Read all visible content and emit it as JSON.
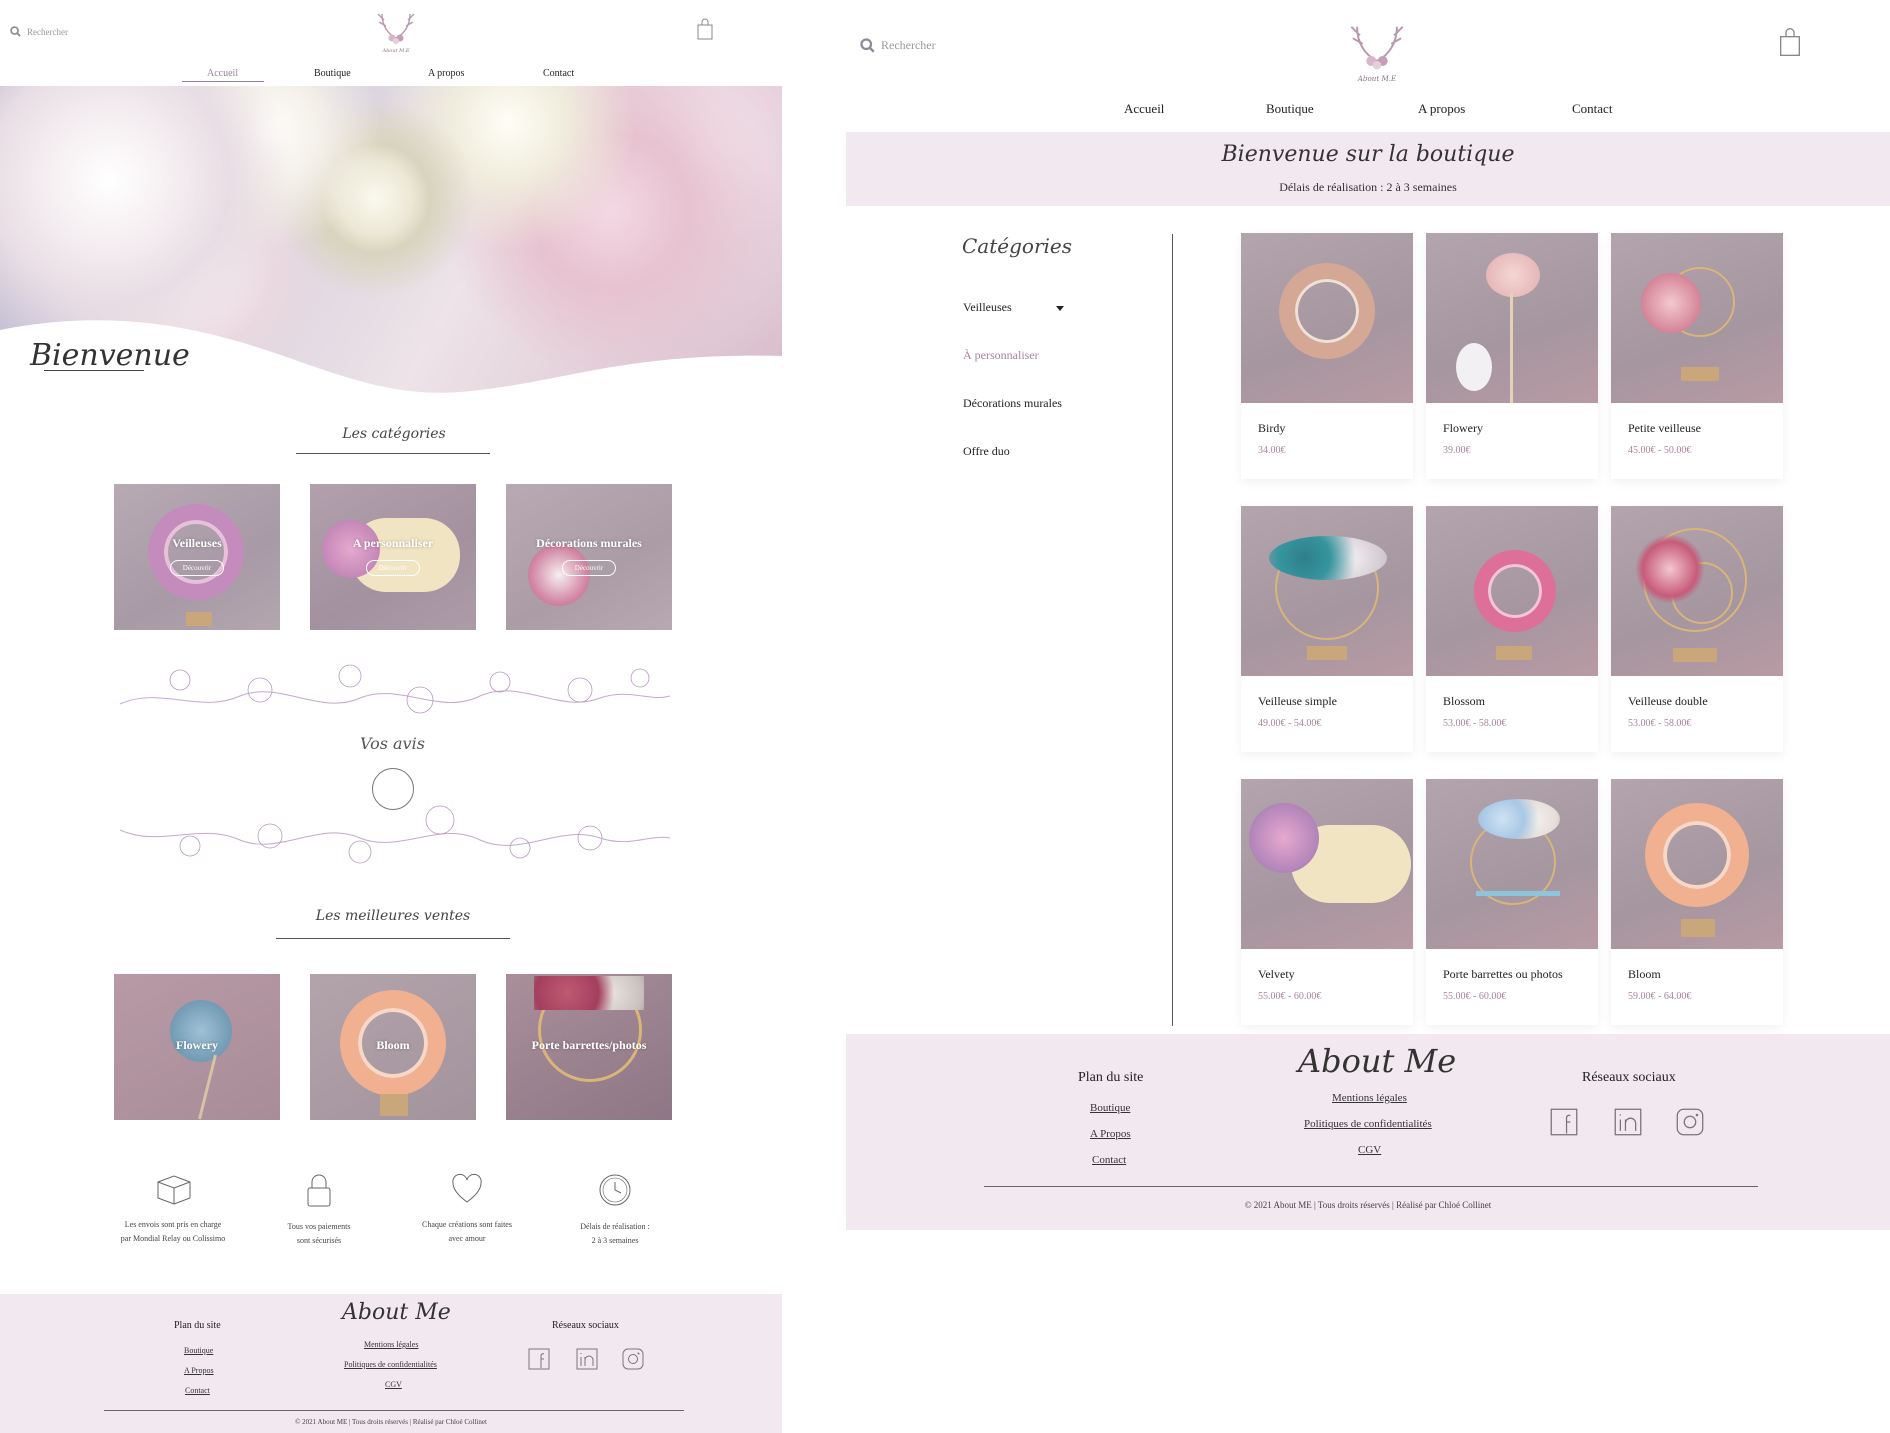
{
  "home": {
    "search_placeholder": "Rechercher",
    "logo_text": "About M.E",
    "nav": [
      "Accueil",
      "Boutique",
      "A propos",
      "Contact"
    ],
    "hero_title": "Bienvenue",
    "categories_title": "Les catégories",
    "categories": [
      {
        "label": "Veilleuses",
        "button": "Découvrir"
      },
      {
        "label": "A personnaliser",
        "button": "Découvrir"
      },
      {
        "label": "Décorations murales",
        "button": "Découvrir"
      }
    ],
    "reviews_title": "Vos avis",
    "bestsellers_title": "Les meilleures ventes",
    "bestsellers": [
      "Flowery",
      "Bloom",
      "Porte barrettes/photos"
    ],
    "features": [
      {
        "icon": "package-icon",
        "text": [
          "Les envois sont pris en charge",
          "par Mondial Relay ou Colissimo"
        ]
      },
      {
        "icon": "padlock-icon",
        "text": [
          "Tous vos paiements",
          "sont sécurisés"
        ]
      },
      {
        "icon": "heart-icon",
        "text": [
          "Chaque créations sont faites",
          "avec amour"
        ]
      },
      {
        "icon": "clock-icon",
        "text": [
          "Délais de réalisation :",
          "2 à 3 semaines"
        ]
      }
    ]
  },
  "shop": {
    "search_placeholder": "Rechercher",
    "nav": [
      "Accueil",
      "Boutique",
      "A propos",
      "Contact"
    ],
    "banner_title": "Bienvenue sur la boutique",
    "banner_subtitle": "Délais de réalisation : 2 à 3 semaines",
    "categories_title": "Catégories",
    "categories": [
      "Veilleuses",
      "À personnaliser",
      "Décorations murales",
      "Offre duo"
    ],
    "products": [
      {
        "name": "Birdy",
        "price": "34.00€"
      },
      {
        "name": "Flowery",
        "price": "39.00€"
      },
      {
        "name": "Petite veilleuse",
        "price": "45.00€ - 50.00€"
      },
      {
        "name": "Veilleuse simple",
        "price": "49.00€ - 54.00€"
      },
      {
        "name": "Blossom",
        "price": "53.00€ - 58.00€"
      },
      {
        "name": "Veilleuse double",
        "price": "53.00€ - 58.00€"
      },
      {
        "name": "Velvety",
        "price": "55.00€ - 60.00€"
      },
      {
        "name": "Porte barrettes ou photos",
        "price": "55.00€ - 60.00€"
      },
      {
        "name": "Bloom",
        "price": "59.00€ - 64.00€"
      }
    ]
  },
  "footer": {
    "sitemap_title": "Plan du site",
    "sitemap": [
      "Boutique",
      "A Propos",
      "Contact"
    ],
    "brand": "About Me",
    "legal": [
      "Mentions légales",
      "Politiques de confidentialités",
      "CGV"
    ],
    "social_title": "Réseaux sociaux",
    "social_icons": [
      "facebook-icon",
      "linkedin-icon",
      "instagram-icon"
    ],
    "copyright_home": "© 2021 About ME | Tous droits réservés | Réalisé par Chloé Collinet",
    "copyright_shop": "© 2021 About ME | Tous droits réservés | Réalisé par Chloé Collinet"
  },
  "colors": {
    "accent": "#a9849c",
    "footer_bg": "#f2e8ef",
    "text": "#2b2b2b"
  }
}
